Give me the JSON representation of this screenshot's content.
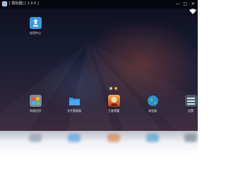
{
  "window": {
    "title": "[ 模拟器] [ 1.0.0 ]",
    "controls": [
      "—",
      "□",
      "✕"
    ]
  },
  "status": {
    "wifi_icon": "wifi-icon"
  },
  "desktop": {
    "top_app": {
      "label": "应用中心",
      "icon": "app-center-icon",
      "color": "#3b9ad9"
    },
    "page_indicator": {
      "pages": 2,
      "current": 1,
      "active_color": "#f0a030",
      "inactive_color": "#bfbfcc"
    },
    "dock": [
      {
        "label": "系统应用",
        "icon": "system-apps-icon",
        "color": "#7d8aa0"
      },
      {
        "label": "文件管理器",
        "icon": "folder-icon",
        "color": "#2f8fe0"
      },
      {
        "label": "王者荣耀",
        "icon": "game-icon",
        "color": "#d46b2a"
      },
      {
        "label": "浏览器",
        "icon": "globe-icon",
        "color": "#2a8fd0"
      },
      {
        "label": "设置",
        "icon": "settings-icon",
        "color": "#5a6a78"
      }
    ]
  }
}
